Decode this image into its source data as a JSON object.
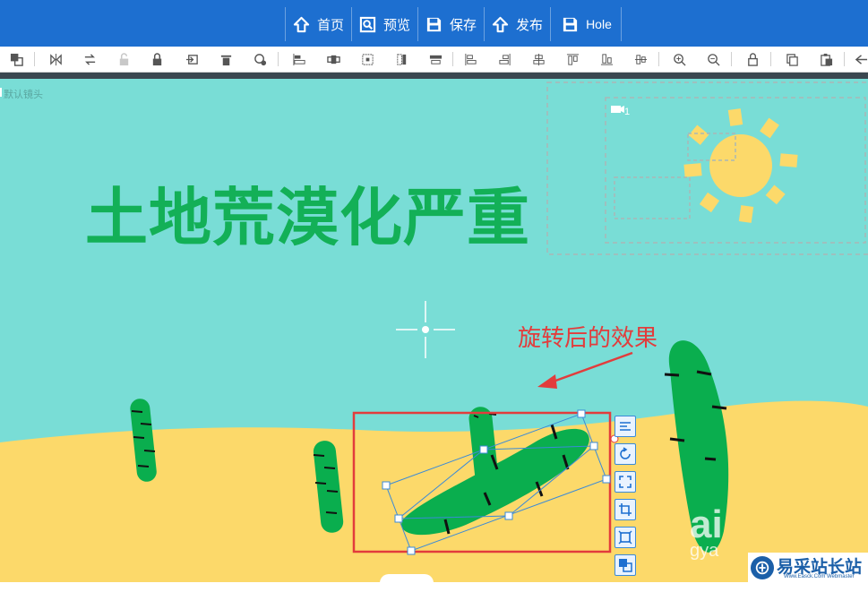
{
  "nav": {
    "items": [
      {
        "label": "首页",
        "icon": "home-icon"
      },
      {
        "label": "预览",
        "icon": "preview-icon"
      },
      {
        "label": "保存",
        "icon": "save-icon"
      },
      {
        "label": "发布",
        "icon": "publish-icon"
      },
      {
        "label": "Hole",
        "icon": "save-icon"
      }
    ]
  },
  "toolbar": {
    "tools": [
      "layer-icon",
      "flip-icon",
      "flip-rotate-icon",
      "unlock-icon",
      "lock-icon",
      "export-icon",
      "delete-icon",
      "paint-icon",
      "align-left-icon",
      "align-center-h-icon",
      "distribute-icon",
      "align-vertical-icon",
      "align-middle-icon",
      "align-top-left-icon",
      "align-bottom-left-icon",
      "align-center-icon",
      "align-top-icon",
      "align-bottom-icon",
      "align-middle-h-icon",
      "zoom-in-icon",
      "zoom-out-icon",
      "lock-icon",
      "copy-icon",
      "paste-icon",
      "back-icon"
    ]
  },
  "canvas": {
    "camera_label": "默认镜头",
    "camera_number": "1",
    "headline": "土地荒漠化严重",
    "annotation": "旋转后的效果",
    "background_color": "#79ddd6",
    "sand_color": "#fcd96a",
    "cactus_color": "#0aae4e",
    "sun_color": "#fcd96a",
    "watermark": "ai",
    "watermark_sub": "gya"
  },
  "float_panel": {
    "buttons": [
      "align-distribute-icon",
      "rotate-icon",
      "expand-icon",
      "crop-icon",
      "fit-icon",
      "layer-down-icon"
    ]
  },
  "logo": {
    "title": "易采站长站",
    "subtitle": "Www.Easck.Com  Webmaster"
  }
}
